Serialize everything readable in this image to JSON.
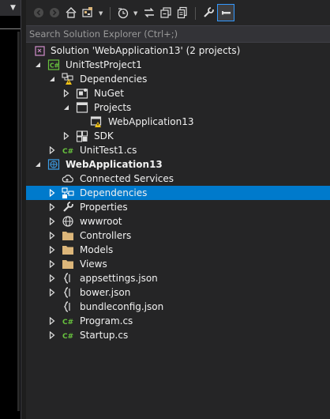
{
  "search": {
    "placeholder": "Search Solution Explorer (Ctrl+;)"
  },
  "toolbar": {
    "buttons": [
      "back",
      "forward",
      "home",
      "switch-views",
      "pending-changes-filter",
      "sync-with-active-document",
      "collapse-all",
      "show-all-files",
      "properties",
      "preview-selected-items"
    ]
  },
  "tree": {
    "solution": "Solution 'WebApplication13' (2 projects)",
    "unit_test_project": "UnitTestProject1",
    "utp_dependencies": "Dependencies",
    "nuget": "NuGet",
    "projects": "Projects",
    "webapp_ref": "WebApplication13",
    "sdk": "SDK",
    "unittest1": "UnitTest1.cs",
    "webapp": "WebApplication13",
    "connected_services": "Connected Services",
    "wa_dependencies": "Dependencies",
    "properties": "Properties",
    "wwwroot": "wwwroot",
    "controllers": "Controllers",
    "models": "Models",
    "views": "Views",
    "appsettings": "appsettings.json",
    "bower": "bower.json",
    "bundleconfig": "bundleconfig.json",
    "program": "Program.cs",
    "startup": "Startup.cs"
  },
  "colors": {
    "selection": "#007acc",
    "folder": "#dcb67a",
    "csharp": "#68c33e",
    "warning": "#f5c518"
  }
}
